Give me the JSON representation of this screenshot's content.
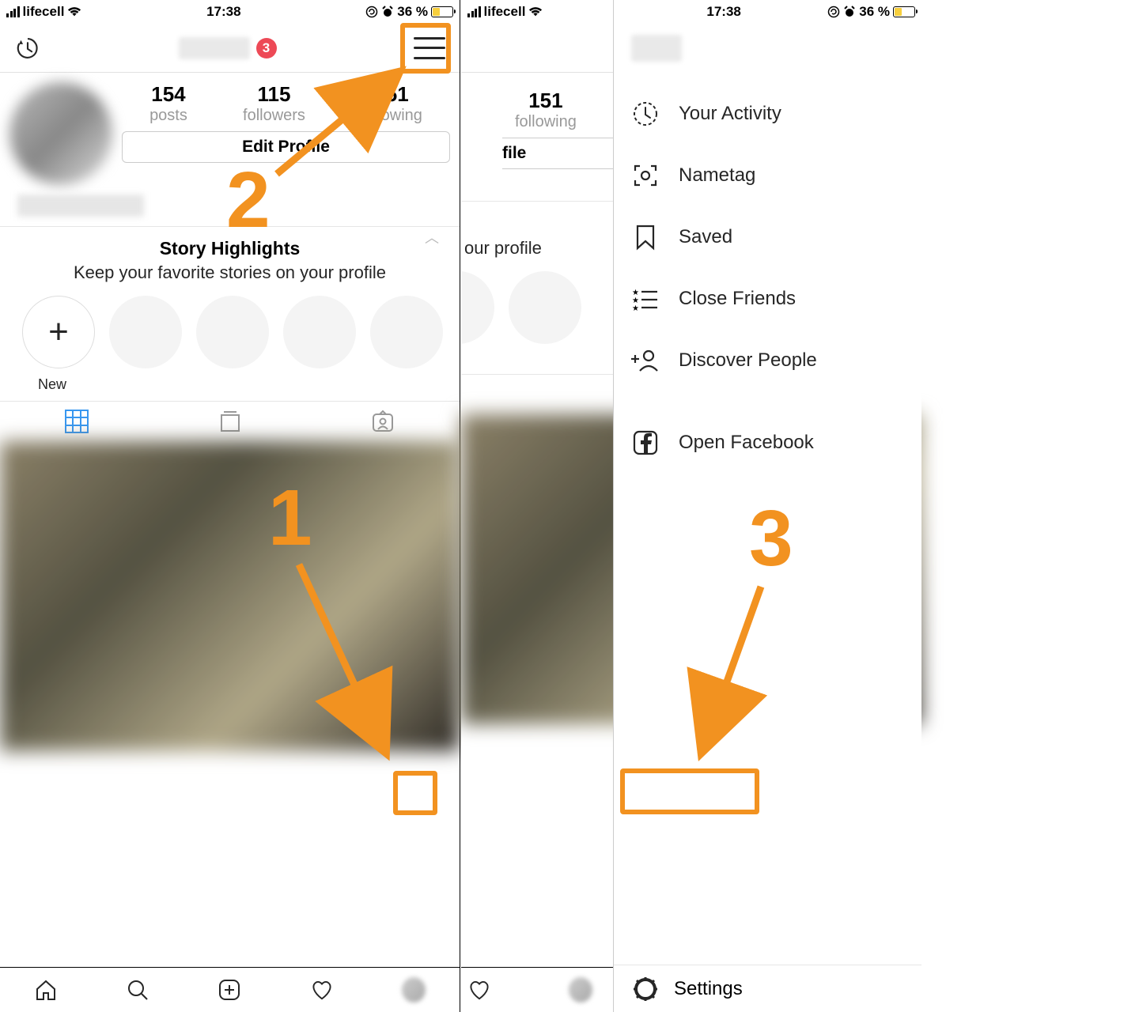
{
  "status": {
    "carrier": "lifecell",
    "time": "17:38",
    "battery_pct": "36 %"
  },
  "profile": {
    "badge_count": "3",
    "posts": "154",
    "posts_lbl": "posts",
    "followers": "115",
    "followers_lbl": "followers",
    "following": "151",
    "following_lbl": "following",
    "edit_btn": "Edit Profile",
    "highlights_title": "Story Highlights",
    "highlights_sub": "Keep your favorite stories on your profile",
    "new_lbl": "New",
    "right_following": "151",
    "right_following_lbl": "following",
    "right_edit_tail": "file",
    "right_hl_sub_tail": "our profile"
  },
  "menu": {
    "items": [
      {
        "label": "Your Activity"
      },
      {
        "label": "Nametag"
      },
      {
        "label": "Saved"
      },
      {
        "label": "Close Friends"
      },
      {
        "label": "Discover People"
      },
      {
        "label": "Open Facebook"
      }
    ],
    "settings": "Settings"
  },
  "ann": {
    "one": "1",
    "two": "2",
    "three": "3"
  }
}
